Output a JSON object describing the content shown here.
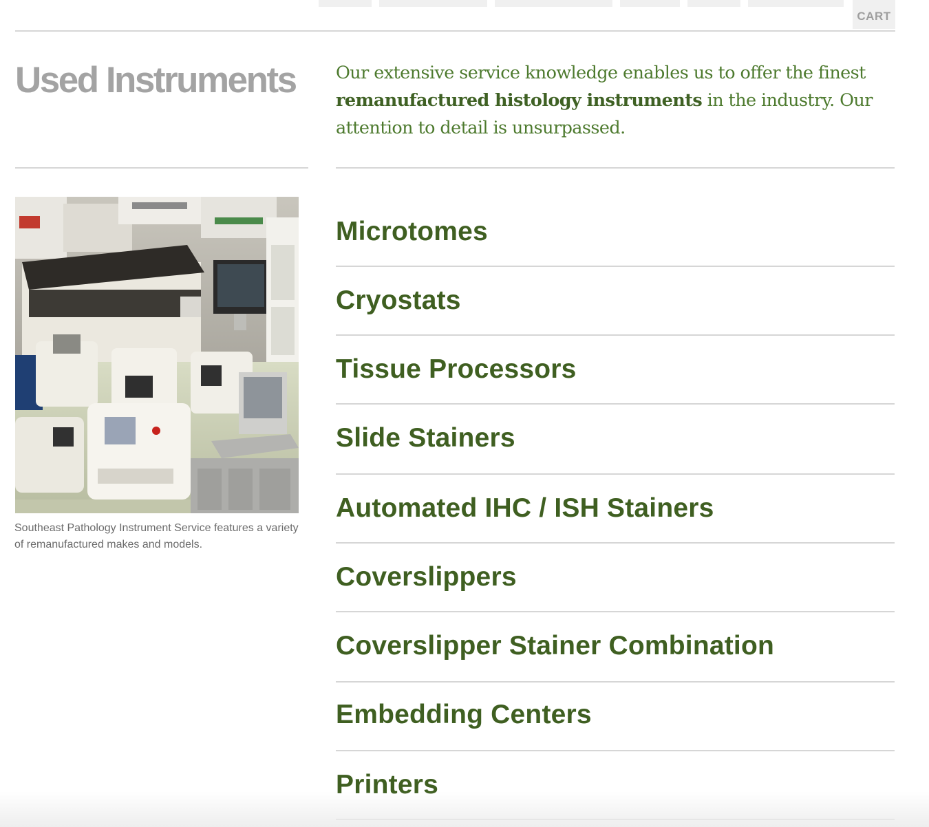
{
  "header": {
    "cart_label": "CART"
  },
  "page": {
    "title": "Used Instruments",
    "intro": {
      "before": "Our extensive service knowledge enables us to offer the finest ",
      "emphasis": "remanufactured histology instruments",
      "after": " in the industry. Our attention to detail is unsurpassed."
    },
    "caption": "Southeast Pathology Instrument Service features a variety of remanufactured makes and models."
  },
  "categories": [
    {
      "label": "Microtomes"
    },
    {
      "label": "Cryostats"
    },
    {
      "label": "Tissue Processors"
    },
    {
      "label": "Slide Stainers"
    },
    {
      "label": "Automated IHC / ISH Stainers"
    },
    {
      "label": "Coverslippers"
    },
    {
      "label": "Coverslipper Stainer Combination"
    },
    {
      "label": "Embedding Centers"
    },
    {
      "label": "Printers"
    }
  ],
  "colors": {
    "accent_green": "#3f5f21",
    "intro_green": "#4d7a2e",
    "title_gray": "#a3a3a3",
    "divider": "#d6d6d6"
  }
}
